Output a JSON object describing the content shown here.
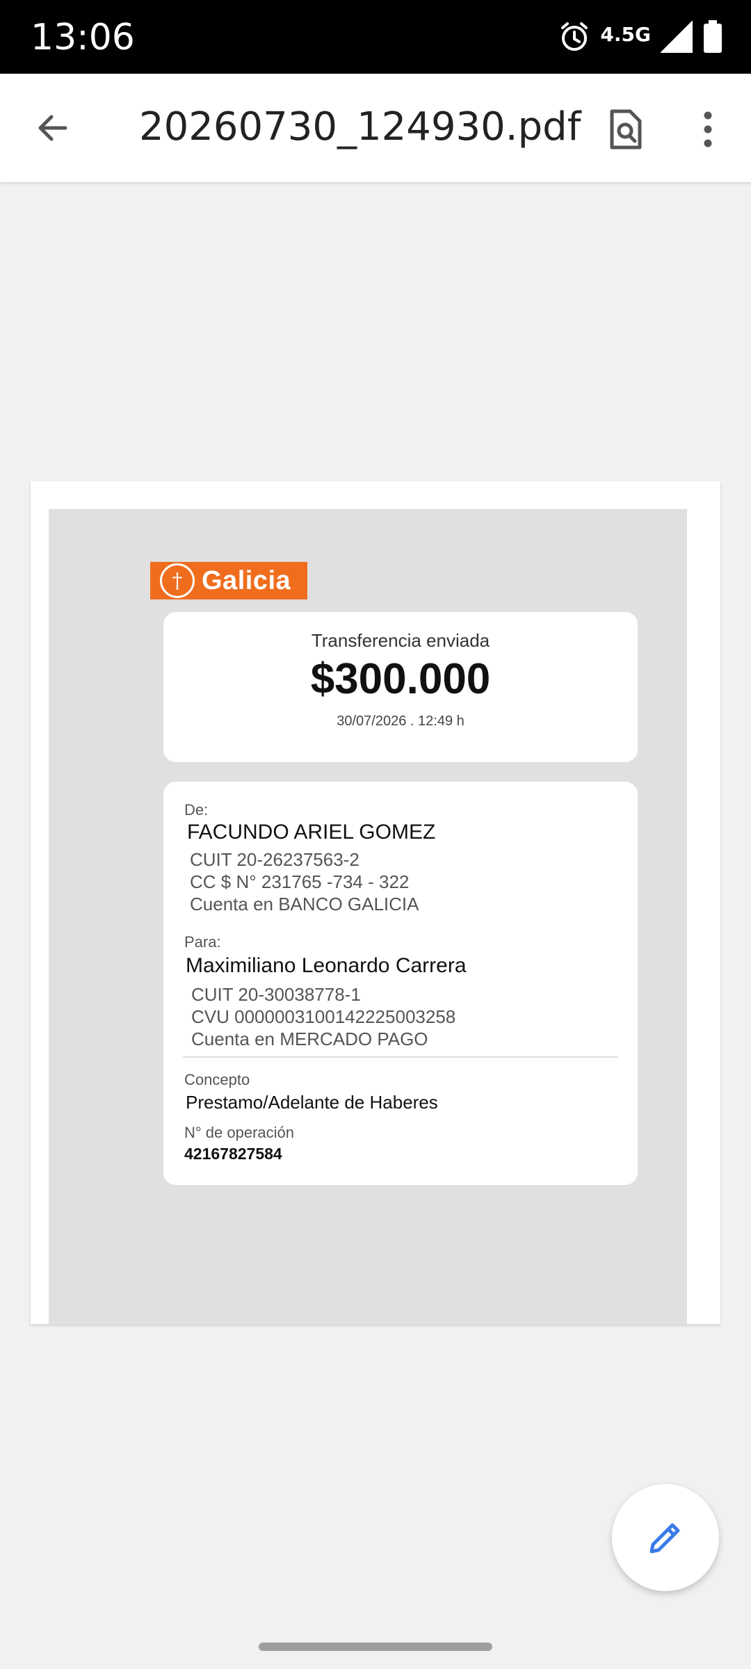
{
  "status": {
    "time": "13:06",
    "network": "4.5G"
  },
  "toolbar": {
    "title": "20260730_124930.pdf"
  },
  "receipt": {
    "brand": "Galicia",
    "transfer_label": "Transferencia enviada",
    "amount": "$300.000",
    "datetime": "30/07/2026 . 12:49 h",
    "from": {
      "label": "De:",
      "name": "FACUNDO ARIEL GOMEZ",
      "cuit": "CUIT 20-26237563-2",
      "account": "CC $ N° 231765 -734 - 322",
      "bank": "Cuenta en BANCO GALICIA"
    },
    "to": {
      "label": "Para:",
      "name": "Maximiliano Leonardo Carrera",
      "cuit": "CUIT 20-30038778-1",
      "cvu": "CVU 0000003100142225003258",
      "bank": "Cuenta en MERCADO PAGO"
    },
    "concept_label": "Concepto",
    "concept": "Prestamo/Adelante de Haberes",
    "operation_label": "N° de operación",
    "operation_number": "42167827584"
  },
  "colors": {
    "brand": "#f06d1d",
    "fab_icon": "#3b7be8"
  }
}
